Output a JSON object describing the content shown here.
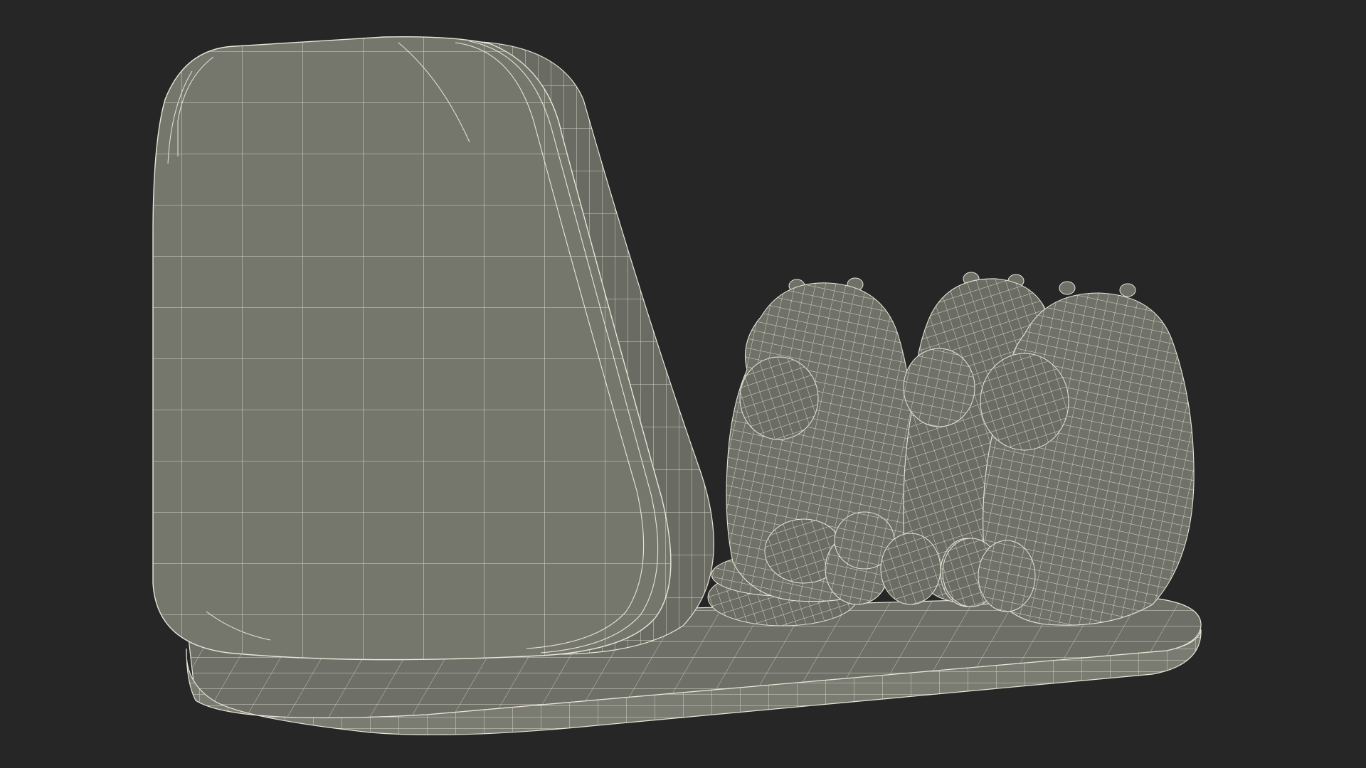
{
  "scene": {
    "background": "#262626",
    "mesh_fill": "#75766c",
    "mesh_fill_dark": "#62635a",
    "wire_color": "#e8e6d8",
    "objects": [
      "display-base",
      "phone-stand-back",
      "charging-pad",
      "bear-left",
      "bear-middle",
      "bear-right"
    ]
  }
}
